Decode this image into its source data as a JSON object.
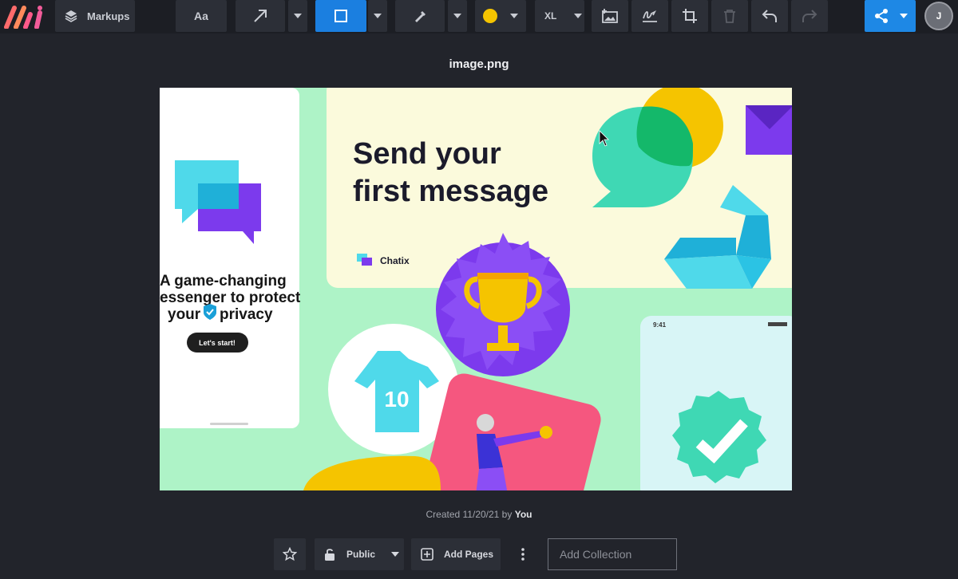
{
  "toolbar": {
    "markups_label": "Markups",
    "text_tool_label": "Aa",
    "size_label": "XL",
    "color_swatch": "#f5c400",
    "accent": "#1e88e5"
  },
  "user": {
    "initial": "J"
  },
  "file": {
    "name": "image.png"
  },
  "artwork": {
    "headline_line1": "Send your",
    "headline_line2": "first message",
    "brand": "Chatix",
    "tagline_line1": "A game-changing",
    "tagline_line2": "essenger to protect",
    "tagline_line3a": "your",
    "tagline_line3b": "privacy",
    "cta": "Let's start!",
    "jersey_number": "10",
    "phone_time": "9:41"
  },
  "footer": {
    "created_prefix": "Created 11/20/21 by",
    "created_by": "You",
    "visibility_label": "Public",
    "add_pages_label": "Add Pages",
    "collection_placeholder": "Add Collection"
  }
}
